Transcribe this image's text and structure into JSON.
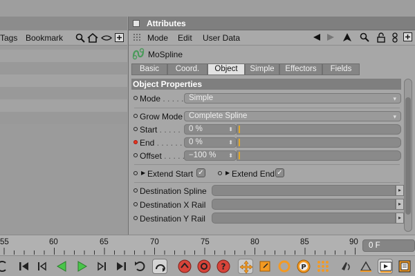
{
  "left_panel": {
    "menu": [
      "Tags",
      "Bookmark"
    ],
    "icons": [
      "search-icon",
      "home-icon",
      "eye-icon",
      "new-panel-icon"
    ]
  },
  "attributes": {
    "title": "Attributes",
    "menu": [
      "Mode",
      "Edit",
      "User Data"
    ],
    "menu_icons": [
      "back-arrow-icon",
      "forward-arrow-icon",
      "up-arrow-icon",
      "search-icon",
      "lock-icon",
      "link-icon",
      "new-panel-icon"
    ],
    "object_name": "MoSpline",
    "tabs": [
      "Basic",
      "Coord.",
      "Object",
      "Simple",
      "Effectors",
      "Fields"
    ],
    "active_tab": "Object",
    "section_title": "Object Properties",
    "params": {
      "mode": {
        "label": "Mode",
        "dots": " . . . . .",
        "value": "Simple"
      },
      "grow_mode": {
        "label": "Grow Mode",
        "value": "Complete Spline"
      },
      "start": {
        "label": "Start",
        "dots": " . . . . .",
        "value": "0 %",
        "slider": 0.0
      },
      "end": {
        "label": "End",
        "dots": " . . . . . .",
        "value": "0 %",
        "slider": 0.0
      },
      "offset": {
        "label": "Offset",
        "dots": " . . . . .",
        "value": "−100 %",
        "slider": 0.0
      },
      "extend_start": {
        "label": "Extend Start",
        "checked": true
      },
      "extend_end": {
        "label": "Extend End",
        "checked": true
      },
      "destination_spline": {
        "label": "Destination Spline",
        "value": ""
      },
      "destination_x_rail": {
        "label": "Destination X Rail",
        "value": ""
      },
      "destination_y_rail": {
        "label": "Destination Y Rail",
        "value": ""
      }
    }
  },
  "timeline": {
    "ticks": [
      "55",
      "60",
      "65",
      "70",
      "75",
      "80",
      "85",
      "90"
    ],
    "current_frame": "0 F"
  },
  "colors": {
    "keyframe_red": "#e23a1e",
    "slider_marker": "#e0a82a",
    "play_green": "#49c54a",
    "record_red": "#d8443a",
    "motion_orange": "#f39a23"
  }
}
